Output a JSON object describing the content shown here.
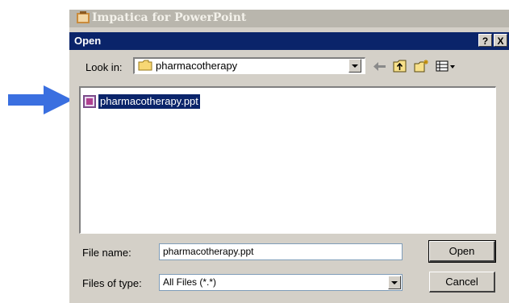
{
  "app": {
    "title": "Impatica for PowerPoint"
  },
  "dialog": {
    "title": "Open",
    "help_label": "?",
    "close_label": "X",
    "look_in_label": "Look in:",
    "look_in_value": "pharmacotherapy",
    "files": [
      {
        "name": "pharmacotherapy.ppt",
        "selected": true
      }
    ],
    "file_name_label": "File name:",
    "file_name_value": "pharmacotherapy.ppt",
    "file_type_label": "Files of type:",
    "file_type_value": "All Files (*.*)",
    "open_button": "Open",
    "cancel_button": "Cancel"
  },
  "icons": {
    "pointer": "arrow-right-icon",
    "folder": "folder-icon",
    "file": "powerpoint-file-icon",
    "back": "back-arrow-icon",
    "up": "up-folder-icon",
    "new_folder": "new-folder-icon",
    "views": "views-menu-icon"
  },
  "colors": {
    "pointer_arrow": "#3a6fe0",
    "titlebar": "#0a246a",
    "selection": "#0a246a",
    "dialog_face": "#d4d0c8"
  }
}
